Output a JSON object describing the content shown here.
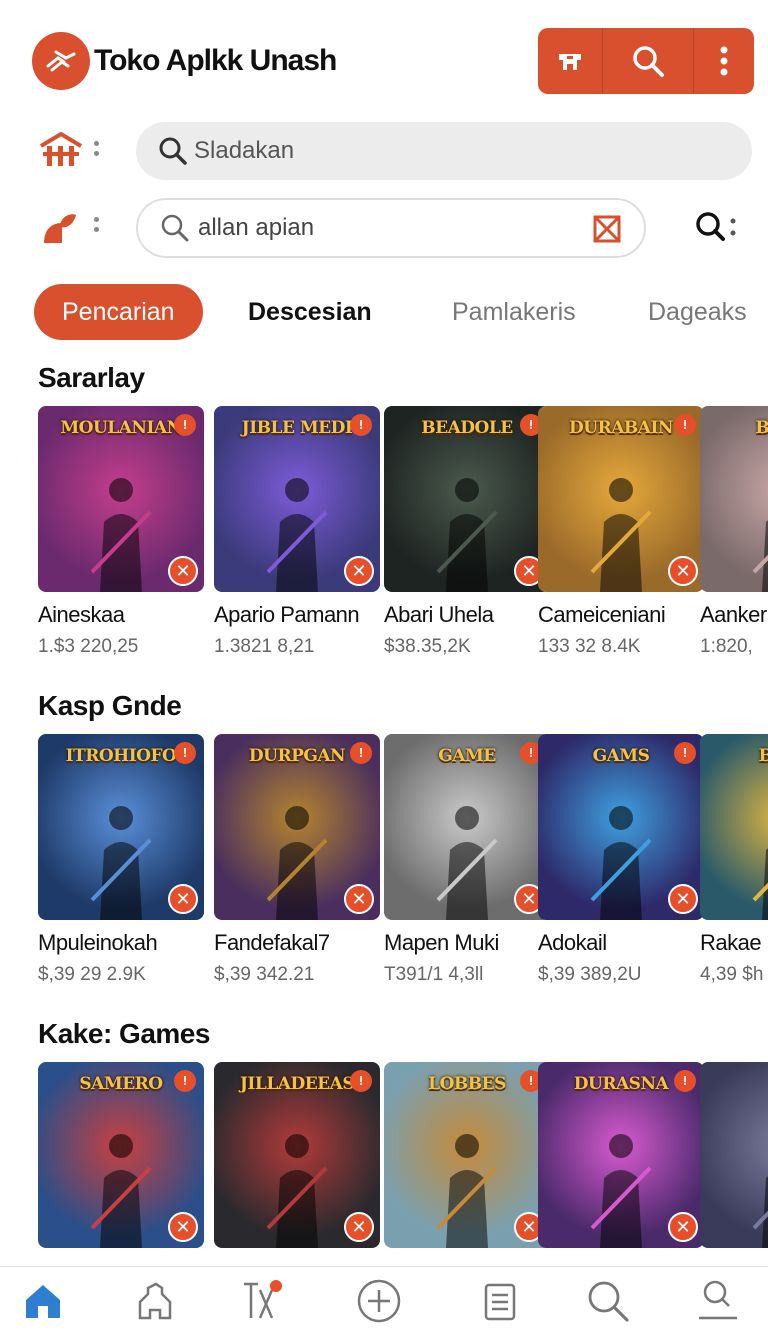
{
  "header": {
    "app_title": "Toko Aplkk Unash",
    "logo_icon": "hand-leaf-icon",
    "toolbar": [
      "store-icon",
      "search-icon",
      "more-vert-icon"
    ],
    "accent_color": "#d9502e"
  },
  "search_primary": {
    "placeholder": "Sladakan",
    "row_icon": "home-icon"
  },
  "search_secondary": {
    "value": "allan apian",
    "row_icon": "leaf-icon",
    "clear_icon": "close-box-icon",
    "trailing_icon": "search-icon"
  },
  "tabs": [
    {
      "label": "Pencarian",
      "active": true
    },
    {
      "label": "Descesian",
      "active": false
    },
    {
      "label": "Pamlakeris",
      "active": false
    },
    {
      "label": "Dageaks",
      "active": false
    }
  ],
  "sections": [
    {
      "title": "Sararlay",
      "items": [
        {
          "art_title": "MOULANIAN",
          "name": "Aineskaa",
          "price": "1.$3 220,25",
          "bg": "#6b2a6e",
          "accent": "#c43e8c"
        },
        {
          "art_title": "JIBLE MEDI",
          "name": "Apario Pamann",
          "price": "1.3821 8,21",
          "bg": "#3b3a7a",
          "accent": "#7c5cd8"
        },
        {
          "art_title": "BEADOLE",
          "name": "Abari Uhela",
          "price": "$38.35,2K",
          "bg": "#1e2422",
          "accent": "#4b5a4e"
        },
        {
          "art_title": "DURABAIN",
          "name": "Cameiceniani",
          "price": "133 32 8.4K",
          "bg": "#9a6a2a",
          "accent": "#e5a83b"
        },
        {
          "art_title": "BBNE",
          "name": "Aanker",
          "price": "1:820,",
          "bg": "#7a6a6a",
          "accent": "#c9a6a6"
        }
      ]
    },
    {
      "title": "Kasp Gnde",
      "items": [
        {
          "art_title": "ITROHIOFO",
          "name": "Mpuleinokah",
          "price": "$,39 29 2.9K",
          "bg": "#1e3a68",
          "accent": "#5a8fd8"
        },
        {
          "art_title": "DURPGAN",
          "name": "Fandefakal7",
          "price": "$,39 342.21",
          "bg": "#4a2f5e",
          "accent": "#b4842f"
        },
        {
          "art_title": "GAME",
          "name": "Mapen Muki",
          "price": "T391/1 4,3ll",
          "bg": "#6d6d6d",
          "accent": "#c9c9c9"
        },
        {
          "art_title": "GAMS",
          "name": "Adokail",
          "price": "$,39 389,2U",
          "bg": "#2e2a6a",
          "accent": "#3fa0e0"
        },
        {
          "art_title": "BEIN",
          "name": "Rakae",
          "price": "4,39 $h",
          "bg": "#2a5a6a",
          "accent": "#e0b63f"
        }
      ]
    },
    {
      "title": "Kake: Games",
      "items": [
        {
          "art_title": "SAMERO",
          "name": "",
          "price": "",
          "bg": "#2a4f8a",
          "accent": "#c94040"
        },
        {
          "art_title": "JILLADEEAS",
          "name": "",
          "price": "",
          "bg": "#2a2a2e",
          "accent": "#b33a3a"
        },
        {
          "art_title": "LOBBES",
          "name": "",
          "price": "",
          "bg": "#7aa0b0",
          "accent": "#c58a3a"
        },
        {
          "art_title": "DURASNA",
          "name": "",
          "price": "",
          "bg": "#4a2a6a",
          "accent": "#d85ad0"
        },
        {
          "art_title": "",
          "name": "",
          "price": "",
          "bg": "#3a3a5a",
          "accent": "#7a7a9a"
        }
      ]
    }
  ],
  "bottom_nav": [
    "home-icon",
    "puzzle-icon",
    "tools-icon",
    "add-circle-icon",
    "clipboard-icon",
    "search-icon",
    "profile-search-icon"
  ]
}
